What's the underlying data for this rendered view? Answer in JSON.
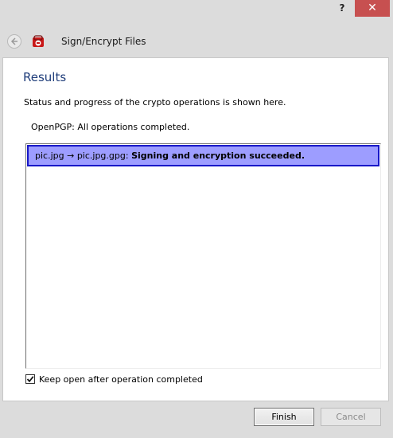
{
  "window": {
    "help_glyph": "?",
    "close_glyph": "✕"
  },
  "header": {
    "title": "Sign/Encrypt Files",
    "back_icon": "arrow-left-circle-icon",
    "app_icon": "kleopatra-icon"
  },
  "page": {
    "title": "Results",
    "description": "Status and progress of the crypto operations is shown here.",
    "status": "OpenPGP: All operations completed."
  },
  "results": [
    {
      "prefix": "pic.jpg → pic.jpg.gpg: ",
      "message": "Signing and encryption succeeded."
    }
  ],
  "options": {
    "keep_open_label": "Keep open after operation completed",
    "keep_open_checked": true
  },
  "buttons": {
    "finish": "Finish",
    "cancel": "Cancel"
  },
  "colors": {
    "selection_fill": "#9d9dff",
    "selection_border": "#1818c8",
    "title_blue": "#1f3d7a",
    "close_red": "#c75050"
  }
}
